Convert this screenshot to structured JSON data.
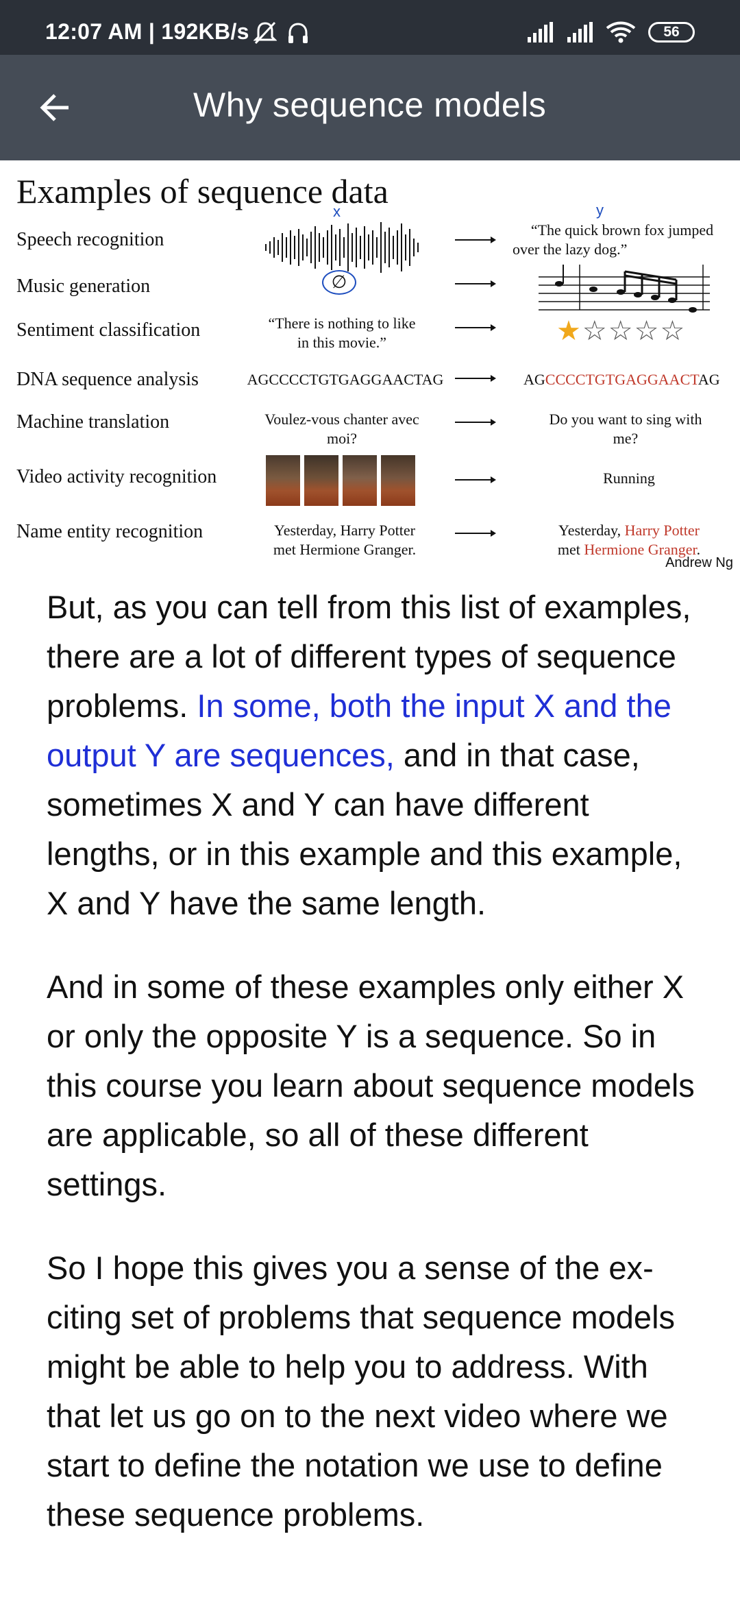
{
  "status_bar": {
    "time": "12:07 AM | 192KB/s",
    "battery": "56",
    "icons": [
      "mute-notifications-icon",
      "headphones-icon",
      "signal-icon",
      "signal-icon",
      "wifi-icon",
      "battery-icon"
    ]
  },
  "app_bar": {
    "title": "Why sequence models",
    "back_icon": "arrow-left-icon"
  },
  "slide": {
    "title": "Examples of sequence data",
    "annotation_x": "x",
    "annotation_y": "y",
    "rows": [
      {
        "label": "Speech recognition",
        "output_line1": "“The quick brown fox jumped",
        "output_line2": "over the lazy dog.”"
      },
      {
        "label": "Music generation",
        "input_symbol": "∅"
      },
      {
        "label": "Sentiment classification",
        "input_line1": "“There is nothing to like",
        "input_line2": "in this movie.”",
        "rating": 1,
        "rating_max": 5
      },
      {
        "label": "DNA sequence analysis",
        "input": "AGCCCCTGTGAGGAACTAG",
        "output_prefix": "AG",
        "output_highlight": "CCCCTGTGAGGAACT",
        "output_suffix": "AG"
      },
      {
        "label": "Machine translation",
        "input_line1": "Voulez-vous chanter avec",
        "input_line2": "moi?",
        "output_line1": "Do you want to sing with",
        "output_line2": "me?"
      },
      {
        "label": "Video activity recognition",
        "output": "Running"
      },
      {
        "label": "Name entity recognition",
        "input_line1": "Yesterday, Harry Potter",
        "input_line2": "met Hermione Granger.",
        "output_line1_plain": "Yesterday, ",
        "output_line1_red": "Harry Potter",
        "output_line2_plain": "met ",
        "output_line2_red": "Hermione Granger",
        "output_line2_end": "."
      }
    ],
    "credit": "Andrew Ng",
    "accent_red": "#c0392b"
  },
  "article": {
    "p1_start": "But, as you can tell from this list of examples, there are a lot of different types of sequence problems. ",
    "p1_highlight": "In some, both the input X and the output Y are sequences,",
    "p1_end": " and in that case, sometimes X and Y can have different lengths, or in this example and this example, X and Y have the same length.",
    "p2": "And in some of these examples only either X or only the opposite Y is a sequence. So in this course you learn about sequence models are applicable, so all of these different settings.",
    "p3": "So I hope this gives you a sense of the ex­citing set of problems that sequence mod­els might be able to help you to address. With that let us go on to the next video where we start to define the notation we use to define these sequence problems.",
    "highlight_color": "#1f2fd6"
  }
}
